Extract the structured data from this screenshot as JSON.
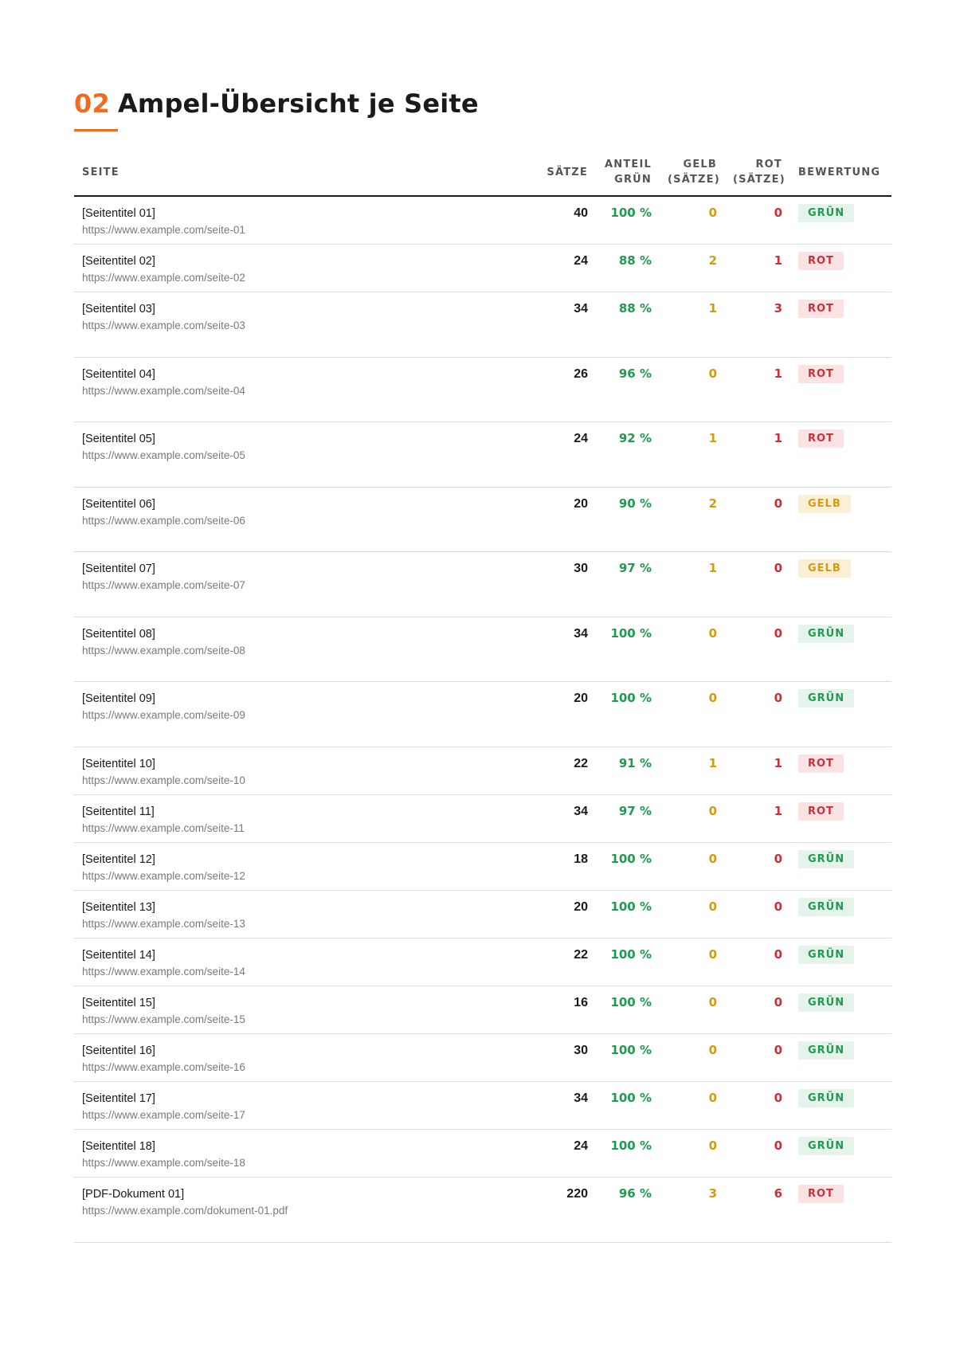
{
  "heading": {
    "number": "02",
    "text": "Ampel-Übersicht je Seite"
  },
  "columns": {
    "seite": "Seite",
    "saetze": "Sätze",
    "anteil_line1": "Anteil",
    "anteil_line2": "Grün",
    "gelb_line1": "Gelb",
    "gelb_line2": "(Sätze)",
    "rot_line1": "Rot",
    "rot_line2": "(Sätze)",
    "bewertung": "Bewertung"
  },
  "rows": [
    {
      "title": "[Seitentitel 01]",
      "url": "https://www.example.com/seite-01",
      "saetze": "40",
      "anteil": "100 %",
      "gelb": "0",
      "rot": "0",
      "bewertung": "GRÜN",
      "status": "gruen"
    },
    {
      "title": "[Seitentitel 02]",
      "url": "https://www.example.com/seite-02",
      "saetze": "24",
      "anteil": "88 %",
      "gelb": "2",
      "rot": "1",
      "bewertung": "ROT",
      "status": "rot"
    },
    {
      "title": "[Seitentitel 03]",
      "url": "https://www.example.com/seite-03",
      "saetze": "34",
      "anteil": "88 %",
      "gelb": "1",
      "rot": "3",
      "bewertung": "ROT",
      "status": "rot"
    },
    {
      "title": "[Seitentitel 04]",
      "url": "https://www.example.com/seite-04",
      "saetze": "26",
      "anteil": "96 %",
      "gelb": "0",
      "rot": "1",
      "bewertung": "ROT",
      "status": "rot"
    },
    {
      "title": "[Seitentitel 05]",
      "url": "https://www.example.com/seite-05",
      "saetze": "24",
      "anteil": "92 %",
      "gelb": "1",
      "rot": "1",
      "bewertung": "ROT",
      "status": "rot"
    },
    {
      "title": "[Seitentitel 06]",
      "url": "https://www.example.com/seite-06",
      "saetze": "20",
      "anteil": "90 %",
      "gelb": "2",
      "rot": "0",
      "bewertung": "GELB",
      "status": "gelb"
    },
    {
      "title": "[Seitentitel 07]",
      "url": "https://www.example.com/seite-07",
      "saetze": "30",
      "anteil": "97 %",
      "gelb": "1",
      "rot": "0",
      "bewertung": "GELB",
      "status": "gelb"
    },
    {
      "title": "[Seitentitel 08]",
      "url": "https://www.example.com/seite-08",
      "saetze": "34",
      "anteil": "100 %",
      "gelb": "0",
      "rot": "0",
      "bewertung": "GRÜN",
      "status": "gruen"
    },
    {
      "title": "[Seitentitel 09]",
      "url": "https://www.example.com/seite-09",
      "saetze": "20",
      "anteil": "100 %",
      "gelb": "0",
      "rot": "0",
      "bewertung": "GRÜN",
      "status": "gruen"
    },
    {
      "title": "[Seitentitel 10]",
      "url": "https://www.example.com/seite-10",
      "saetze": "22",
      "anteil": "91 %",
      "gelb": "1",
      "rot": "1",
      "bewertung": "ROT",
      "status": "rot"
    },
    {
      "title": "[Seitentitel 11]",
      "url": "https://www.example.com/seite-11",
      "saetze": "34",
      "anteil": "97 %",
      "gelb": "0",
      "rot": "1",
      "bewertung": "ROT",
      "status": "rot"
    },
    {
      "title": "[Seitentitel 12]",
      "url": "https://www.example.com/seite-12",
      "saetze": "18",
      "anteil": "100 %",
      "gelb": "0",
      "rot": "0",
      "bewertung": "GRÜN",
      "status": "gruen"
    },
    {
      "title": "[Seitentitel 13]",
      "url": "https://www.example.com/seite-13",
      "saetze": "20",
      "anteil": "100 %",
      "gelb": "0",
      "rot": "0",
      "bewertung": "GRÜN",
      "status": "gruen"
    },
    {
      "title": "[Seitentitel 14]",
      "url": "https://www.example.com/seite-14",
      "saetze": "22",
      "anteil": "100 %",
      "gelb": "0",
      "rot": "0",
      "bewertung": "GRÜN",
      "status": "gruen"
    },
    {
      "title": "[Seitentitel 15]",
      "url": "https://www.example.com/seite-15",
      "saetze": "16",
      "anteil": "100 %",
      "gelb": "0",
      "rot": "0",
      "bewertung": "GRÜN",
      "status": "gruen"
    },
    {
      "title": "[Seitentitel 16]",
      "url": "https://www.example.com/seite-16",
      "saetze": "30",
      "anteil": "100 %",
      "gelb": "0",
      "rot": "0",
      "bewertung": "GRÜN",
      "status": "gruen"
    },
    {
      "title": "[Seitentitel 17]",
      "url": "https://www.example.com/seite-17",
      "saetze": "34",
      "anteil": "100 %",
      "gelb": "0",
      "rot": "0",
      "bewertung": "GRÜN",
      "status": "gruen"
    },
    {
      "title": "[Seitentitel 18]",
      "url": "https://www.example.com/seite-18",
      "saetze": "24",
      "anteil": "100 %",
      "gelb": "0",
      "rot": "0",
      "bewertung": "GRÜN",
      "status": "gruen"
    },
    {
      "title": "[PDF-Dokument 01]",
      "url": "https://www.example.com/dokument-01.pdf",
      "saetze": "220",
      "anteil": "96 %",
      "gelb": "3",
      "rot": "6",
      "bewertung": "ROT",
      "status": "rot"
    }
  ],
  "colors": {
    "accent": "#f06a1f",
    "gruen": "#1f9a50",
    "gelb": "#d19b12",
    "rot": "#c9303c"
  }
}
